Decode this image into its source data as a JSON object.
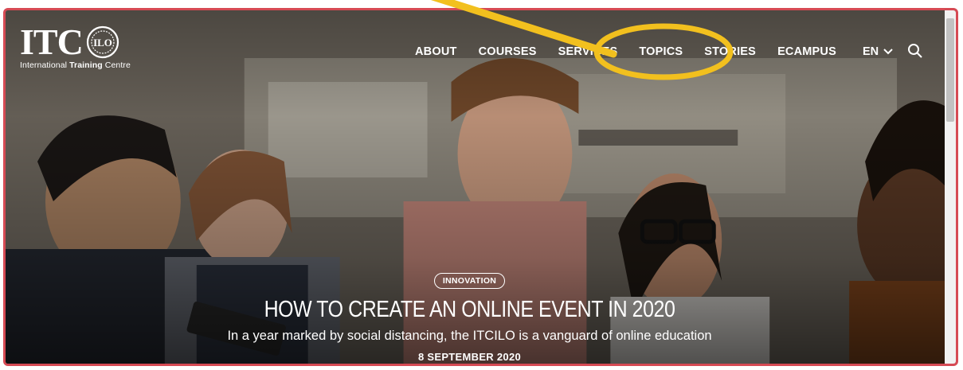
{
  "brand": {
    "logo_text": "ITC",
    "seal_text": "ILO",
    "subtitle_normal": "International ",
    "subtitle_bold": "Training",
    "subtitle_tail": " Centre"
  },
  "nav": {
    "items": [
      "ABOUT",
      "COURSES",
      "SERVICES",
      "TOPICS",
      "STORIES",
      "ECAMPUS"
    ],
    "language": "EN",
    "search_icon": "search-icon"
  },
  "hero": {
    "tag": "INNOVATION",
    "headline": "HOW TO CREATE AN ONLINE EVENT IN 2020",
    "subtitle": "In a year marked by social distancing, the ITCILO is a vanguard of online education",
    "date": "8 SEPTEMBER 2020"
  },
  "annotation": {
    "color": "#f2c01e",
    "shape": "arrow-and-ellipse",
    "highlighted_item": "TOPICS"
  },
  "colors": {
    "frame_border": "#d64a54",
    "text": "#ffffff"
  }
}
